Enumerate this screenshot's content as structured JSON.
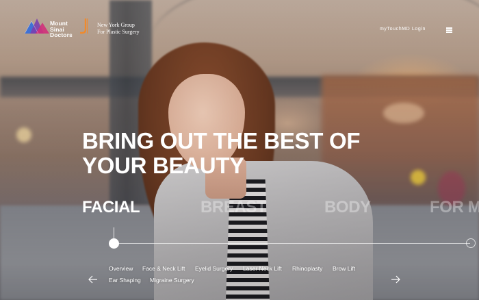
{
  "brand": {
    "logo_lines": [
      "Mount",
      "Sinai",
      "Doctors"
    ],
    "partner_lines": [
      "New York Group",
      "For Plastic Surgery"
    ],
    "colors": {
      "logo_blue": "#3a6fd8",
      "logo_magenta": "#d0307a",
      "logo_purple": "#7a3fb0",
      "partner_orange": "#f08a2c"
    }
  },
  "header": {
    "login_label": "myTouchMD Login",
    "menu_icon": "hamburger-menu-icon"
  },
  "hero": {
    "headline_line1": "BRING OUT THE BEST OF",
    "headline_line2": "YOUR BEAUTY"
  },
  "categories": [
    {
      "label": "FACIAL",
      "active": true
    },
    {
      "label": "BREAST",
      "active": false
    },
    {
      "label": "BODY",
      "active": false
    },
    {
      "label": "FOR MEN",
      "active": false
    }
  ],
  "procedures": {
    "row1": [
      "Overview",
      "Face & Neck Lift",
      "Eyelid Surgery",
      "Laser Neck Lift",
      "Rhinoplasty",
      "Brow Lift"
    ],
    "row2": [
      "Ear Shaping",
      "Migraine Surgery"
    ]
  },
  "nav_icons": {
    "prev": "arrow-left-icon",
    "next": "arrow-right-icon"
  }
}
